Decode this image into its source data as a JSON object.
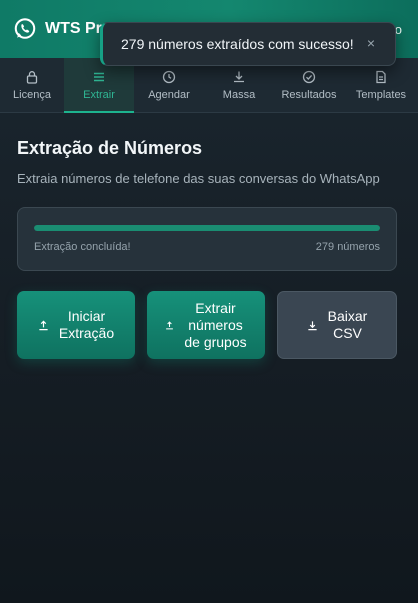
{
  "app": {
    "title": "WTS Pro",
    "header_right": "o"
  },
  "toast": {
    "message": "279 números extraídos com sucesso!",
    "close": "×"
  },
  "tabs": [
    {
      "label": "Licença",
      "icon": "lock-icon",
      "active": false
    },
    {
      "label": "Extrair",
      "icon": "menu-icon",
      "active": true
    },
    {
      "label": "Agendar",
      "icon": "clock-icon",
      "active": false
    },
    {
      "label": "Massa",
      "icon": "download-icon",
      "active": false
    },
    {
      "label": "Resultados",
      "icon": "check-circle-icon",
      "active": false
    },
    {
      "label": "Templates",
      "icon": "document-icon",
      "active": false
    }
  ],
  "main": {
    "title": "Extração de Números",
    "subtitle": "Extraia números de telefone das suas conversas do WhatsApp",
    "progress": {
      "fraction": 1.0,
      "status": "Extração concluída!",
      "count": "279 números"
    },
    "buttons": {
      "start": "Iniciar\nExtração",
      "groups": "Extrair\nnúmeros\nde grupos",
      "csv": "Baixar\nCSV"
    }
  },
  "colors": {
    "accent": "#16917a",
    "header": "#14876f",
    "background": "#1b2730"
  }
}
